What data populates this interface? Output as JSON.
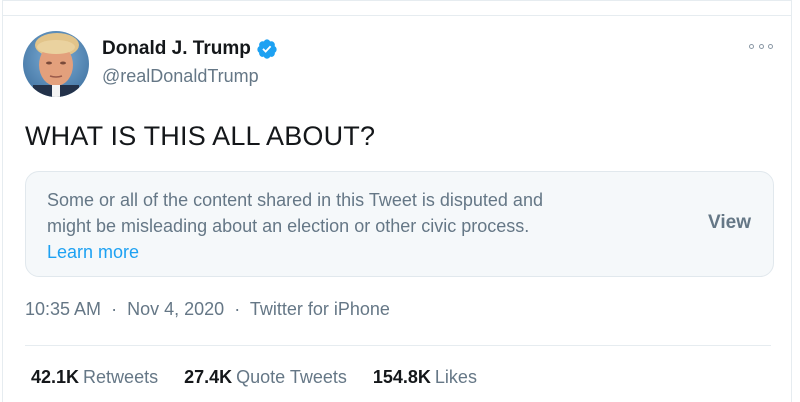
{
  "author": {
    "name": "Donald J. Trump",
    "handle": "@realDonaldTrump",
    "verified": true
  },
  "tweet": {
    "text": "WHAT IS THIS ALL ABOUT?"
  },
  "notice": {
    "line1": "Some or all of the content shared in this Tweet is disputed and",
    "line2": "might be misleading about an election or other civic process.",
    "link": "Learn more",
    "action": "View"
  },
  "meta": {
    "time": "10:35 AM",
    "sep1": "·",
    "date": "Nov 4, 2020",
    "sep2": "·",
    "source": "Twitter for iPhone"
  },
  "stats": {
    "retweets_count": "42.1K",
    "retweets_label": "Retweets",
    "quotes_count": "27.4K",
    "quotes_label": "Quote Tweets",
    "likes_count": "154.8K",
    "likes_label": "Likes"
  },
  "colors": {
    "accent": "#1da1f2",
    "text_primary": "#14171a",
    "text_secondary": "#657786",
    "notice_bg": "#f5f8fa"
  },
  "icons": {
    "verified": "verified-badge-icon",
    "more": "more-options-icon"
  }
}
